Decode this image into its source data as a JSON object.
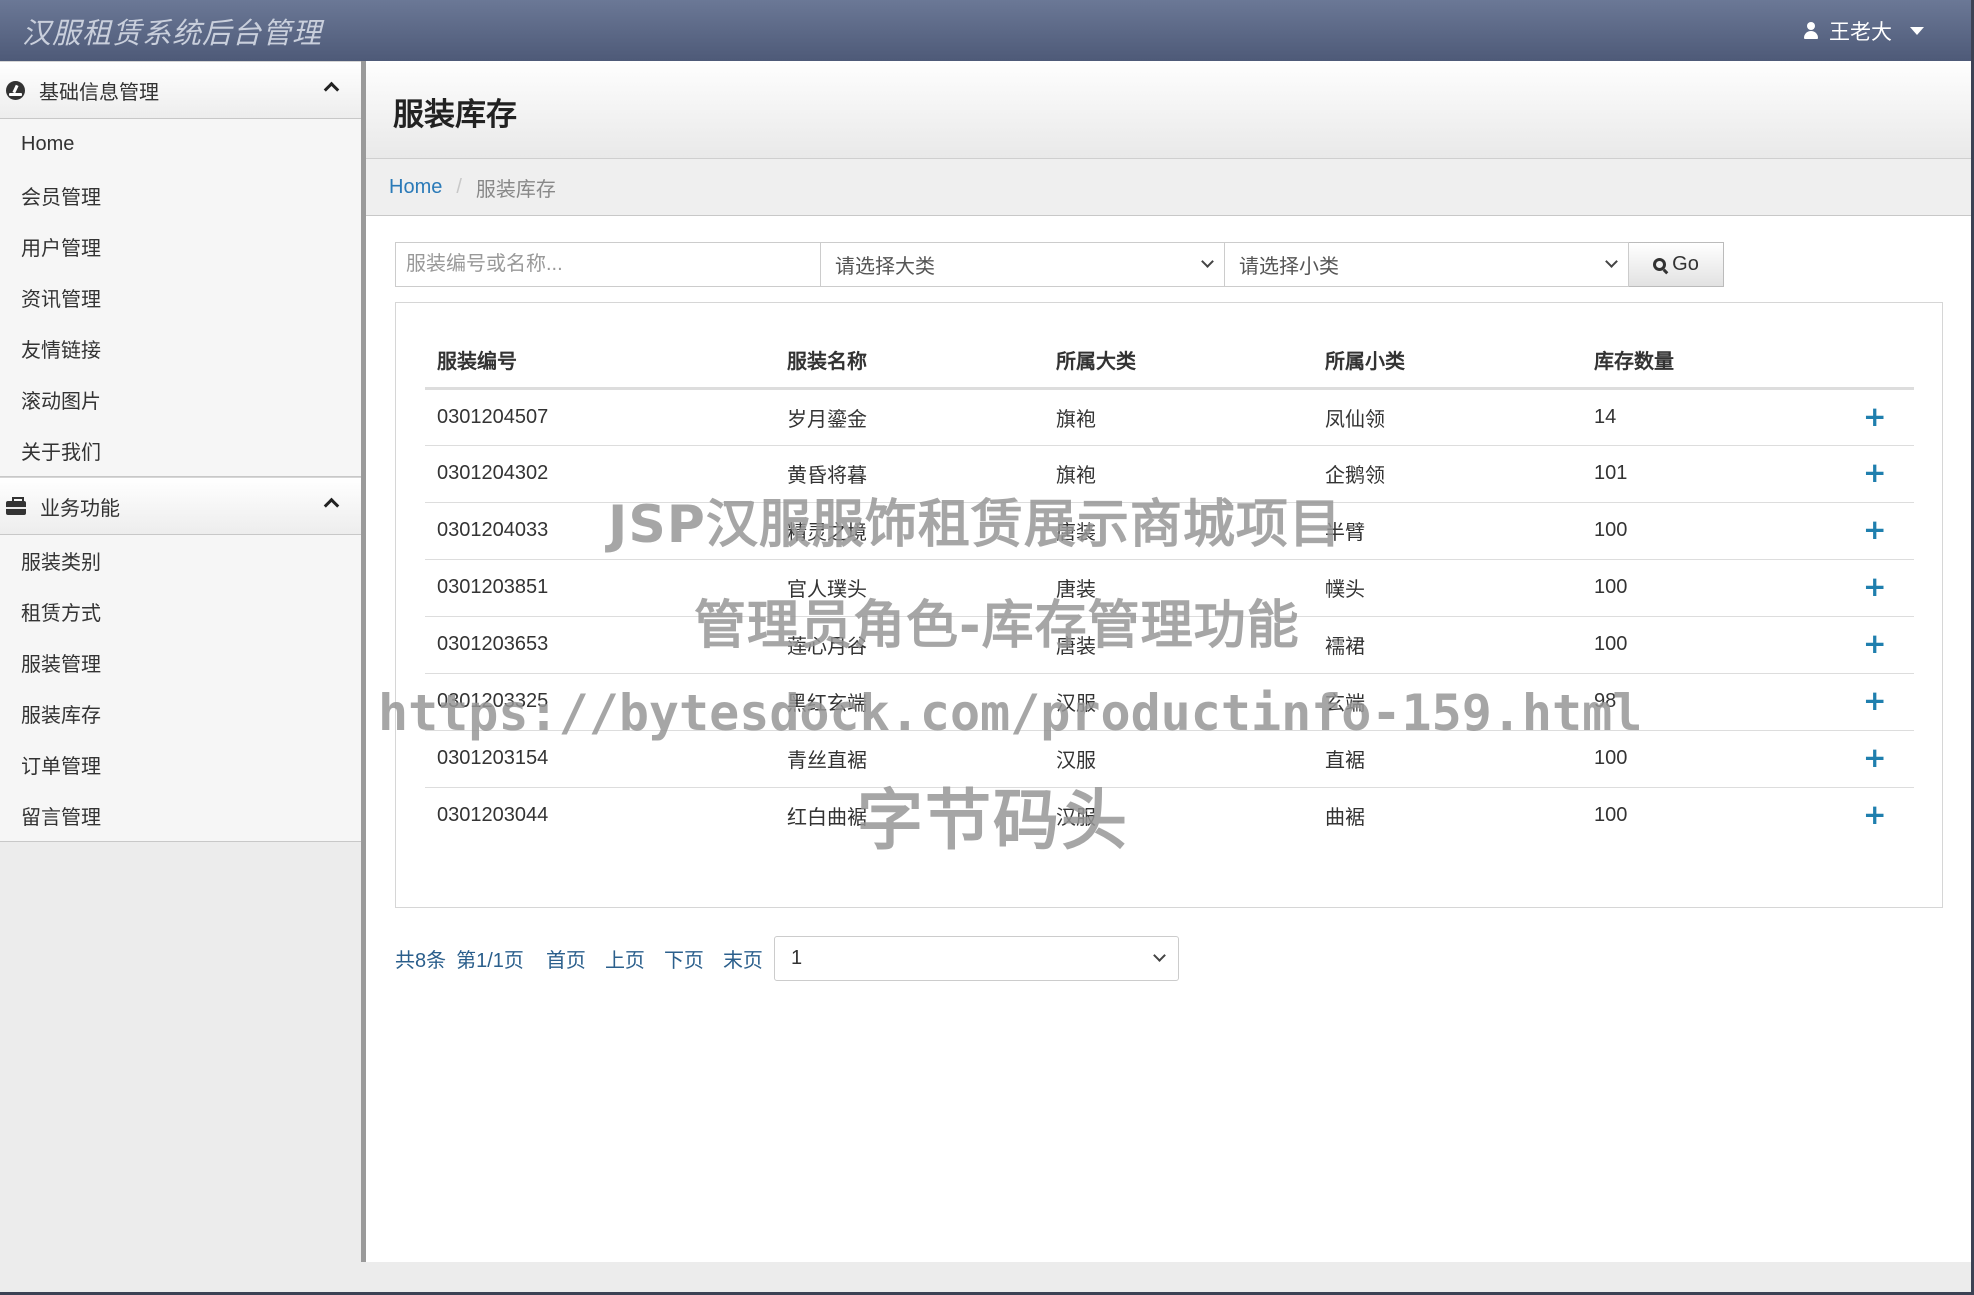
{
  "navbar": {
    "brand": "汉服租赁系统后台管理",
    "user_name": "王老大"
  },
  "sidebar": {
    "groups": [
      {
        "title": "基础信息管理",
        "icon": "dashboard-icon",
        "items": [
          "Home",
          "会员管理",
          "用户管理",
          "资讯管理",
          "友情链接",
          "滚动图片",
          "关于我们"
        ]
      },
      {
        "title": "业务功能",
        "icon": "briefcase-icon",
        "items": [
          "服装类别",
          "租赁方式",
          "服装管理",
          "服装库存",
          "订单管理",
          "留言管理"
        ]
      }
    ]
  },
  "page": {
    "title": "服装库存",
    "breadcrumb": {
      "home": "Home",
      "current": "服装库存"
    }
  },
  "filters": {
    "search_placeholder": "服装编号或名称...",
    "category_select": "请选择大类",
    "subcategory_select": "请选择小类",
    "go_label": "Go"
  },
  "table": {
    "columns": [
      "服装编号",
      "服装名称",
      "所属大类",
      "所属小类",
      "库存数量"
    ],
    "rows": [
      {
        "code": "0301204507",
        "name": "岁月鎏金",
        "category": "旗袍",
        "subcategory": "凤仙领",
        "stock": "14"
      },
      {
        "code": "0301204302",
        "name": "黄昏将暮",
        "category": "旗袍",
        "subcategory": "企鹅领",
        "stock": "101"
      },
      {
        "code": "0301204033",
        "name": "精灵之境",
        "category": "唐装",
        "subcategory": "半臂",
        "stock": "100"
      },
      {
        "code": "0301203851",
        "name": "官人璞头",
        "category": "唐装",
        "subcategory": "幞头",
        "stock": "100"
      },
      {
        "code": "0301203653",
        "name": "莲心月谷",
        "category": "唐装",
        "subcategory": "襦裙",
        "stock": "100"
      },
      {
        "code": "0301203325",
        "name": "黑红玄端",
        "category": "汉服",
        "subcategory": "玄端",
        "stock": "98"
      },
      {
        "code": "0301203154",
        "name": "青丝直裾",
        "category": "汉服",
        "subcategory": "直裾",
        "stock": "100"
      },
      {
        "code": "0301203044",
        "name": "红白曲裾",
        "category": "汉服",
        "subcategory": "曲裾",
        "stock": "100"
      }
    ],
    "action_icon": "plus-icon"
  },
  "pagination": {
    "total": "共8条",
    "page_info": "第1/1页",
    "first": "首页",
    "prev": "上页",
    "next": "下页",
    "last": "末页",
    "page_select": "1"
  },
  "watermark": {
    "line1": "JSP汉服服饰租赁展示商城项目",
    "line2": "管理员角色-库存管理功能",
    "line3": "https://bytesdock.com/productinfo-159.html",
    "line4": "字节码头"
  },
  "colors": {
    "navbar_top": "#6b7896",
    "navbar_bottom": "#4e5a78",
    "link": "#2a7ab8",
    "plus_icon": "#1f7fae"
  }
}
